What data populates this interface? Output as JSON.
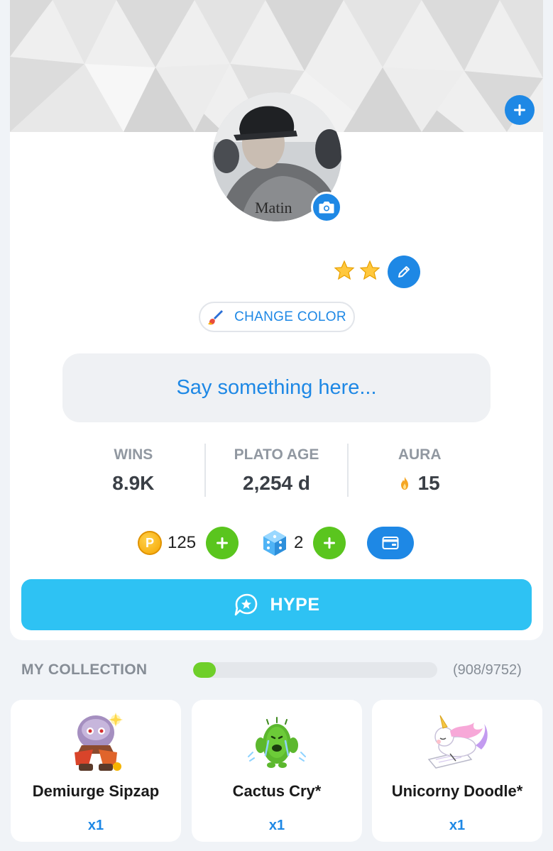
{
  "colors": {
    "accent": "#1e88e5",
    "hype": "#2ec2f3",
    "green": "#5ac51e",
    "progress": "#6fcf2a",
    "background": "#f0f3f7"
  },
  "profile": {
    "avatar_text": "Matin",
    "star_icons": [
      "star-icon",
      "star-icon"
    ],
    "change_color_label": "CHANGE COLOR",
    "status_placeholder": "Say something here..."
  },
  "stats": [
    {
      "label": "WINS",
      "value": "8.9K"
    },
    {
      "label": "PLATO AGE",
      "value": "2,254 d"
    },
    {
      "label": "AURA",
      "value": "15",
      "icon": "flame-icon"
    }
  ],
  "currency": {
    "coins": "125",
    "coin_symbol": "P",
    "gems": "2"
  },
  "hype_label": "HYPE",
  "collection": {
    "title": "MY COLLECTION",
    "count": "(908/9752)",
    "progress": 0.093,
    "items": [
      {
        "name": "Demiurge Sipzap",
        "qty": "x1",
        "icon": "robot-sticker-icon"
      },
      {
        "name": "Cactus Cry*",
        "qty": "x1",
        "icon": "cactus-sticker-icon"
      },
      {
        "name": "Unicorny Doodle*",
        "qty": "x1",
        "icon": "unicorn-sticker-icon"
      }
    ]
  }
}
